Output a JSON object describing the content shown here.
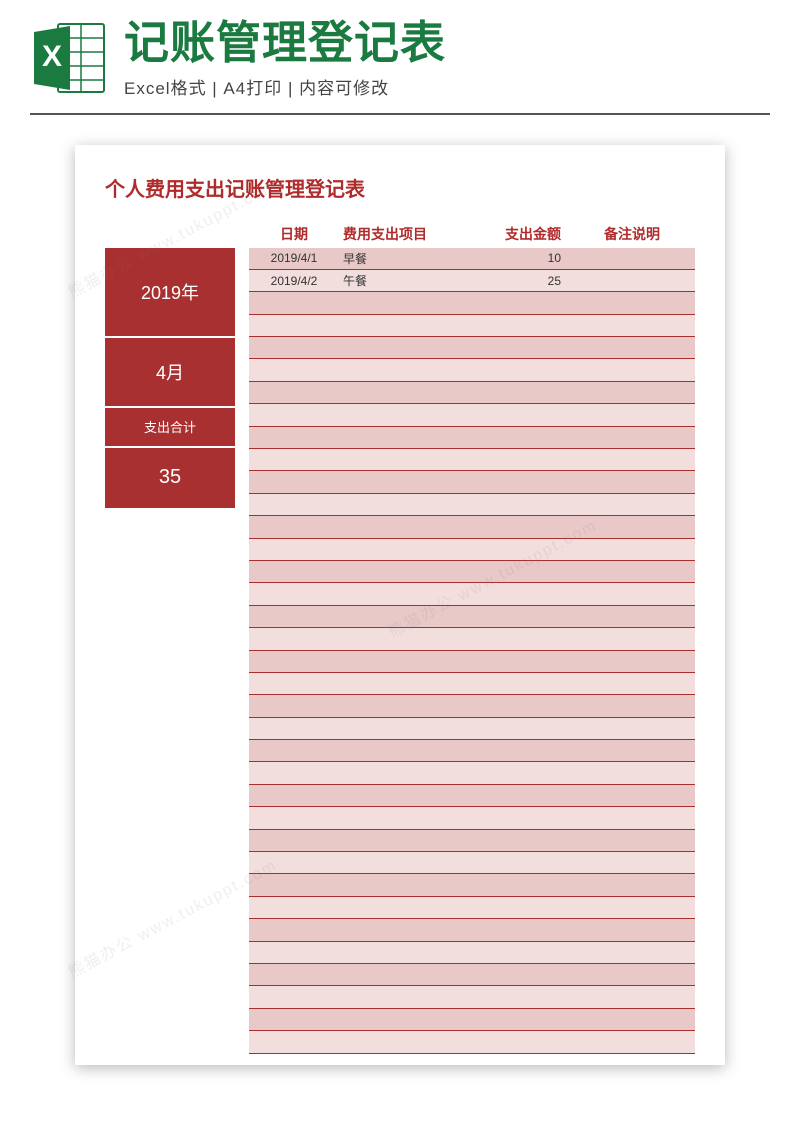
{
  "header": {
    "title": "记账管理登记表",
    "subtitle": "Excel格式 | A4打印 | 内容可修改",
    "icon_letter": "X"
  },
  "document": {
    "title": "个人费用支出记账管理登记表",
    "sidebar": {
      "year": "2019年",
      "month": "4月",
      "total_label": "支出合计",
      "total_value": "35"
    },
    "columns": {
      "date": "日期",
      "item": "费用支出项目",
      "amount": "支出金额",
      "note": "备注说明"
    },
    "rows": [
      {
        "date": "2019/4/1",
        "item": "早餐",
        "amount": "10",
        "note": ""
      },
      {
        "date": "2019/4/2",
        "item": "午餐",
        "amount": "25",
        "note": ""
      }
    ],
    "empty_row_count": 34
  },
  "watermark": "熊猫办公 www.tukuppt.com"
}
